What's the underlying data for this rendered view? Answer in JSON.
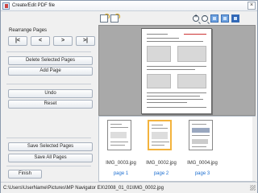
{
  "window": {
    "title": "Create/Edit PDF file",
    "close_glyph": "×"
  },
  "left": {
    "rearrange_label": "Rearrange Pages",
    "nav": [
      {
        "name": "first-page-button",
        "glyph": "|<"
      },
      {
        "name": "previous-page-button",
        "glyph": "<"
      },
      {
        "name": "next-page-button",
        "glyph": ">"
      },
      {
        "name": "last-page-button",
        "glyph": ">|"
      }
    ],
    "delete_selected_pages": "Delete Selected Pages",
    "add_page": "Add Page",
    "undo": "Undo",
    "reset": "Reset",
    "save_selected_pages": "Save Selected Pages",
    "save_all_pages": "Save All Pages",
    "finish": "Finish"
  },
  "toolbar": {
    "icons": [
      "rotate-left-icon",
      "rotate-right-icon",
      "zoom-in-icon",
      "zoom-out-icon",
      "single-view-icon",
      "list-view-icon",
      "fit-view-icon"
    ]
  },
  "thumbnails": [
    {
      "file": "IMG_0003.jpg",
      "page": "page 1",
      "selected": false
    },
    {
      "file": "IMG_0002.jpg",
      "page": "page 2",
      "selected": true
    },
    {
      "file": "IMG_0004.jpg",
      "page": "page 3",
      "selected": false
    }
  ],
  "status": {
    "path": "C:\\Users\\UserName\\Pictures\\MP Navigator EX\\2008_01_01\\IMG_0002.jpg"
  },
  "colors": {
    "selection": "#f3b33d",
    "page_link": "#1e6fd0",
    "preview_bg": "#a9a9a9"
  }
}
